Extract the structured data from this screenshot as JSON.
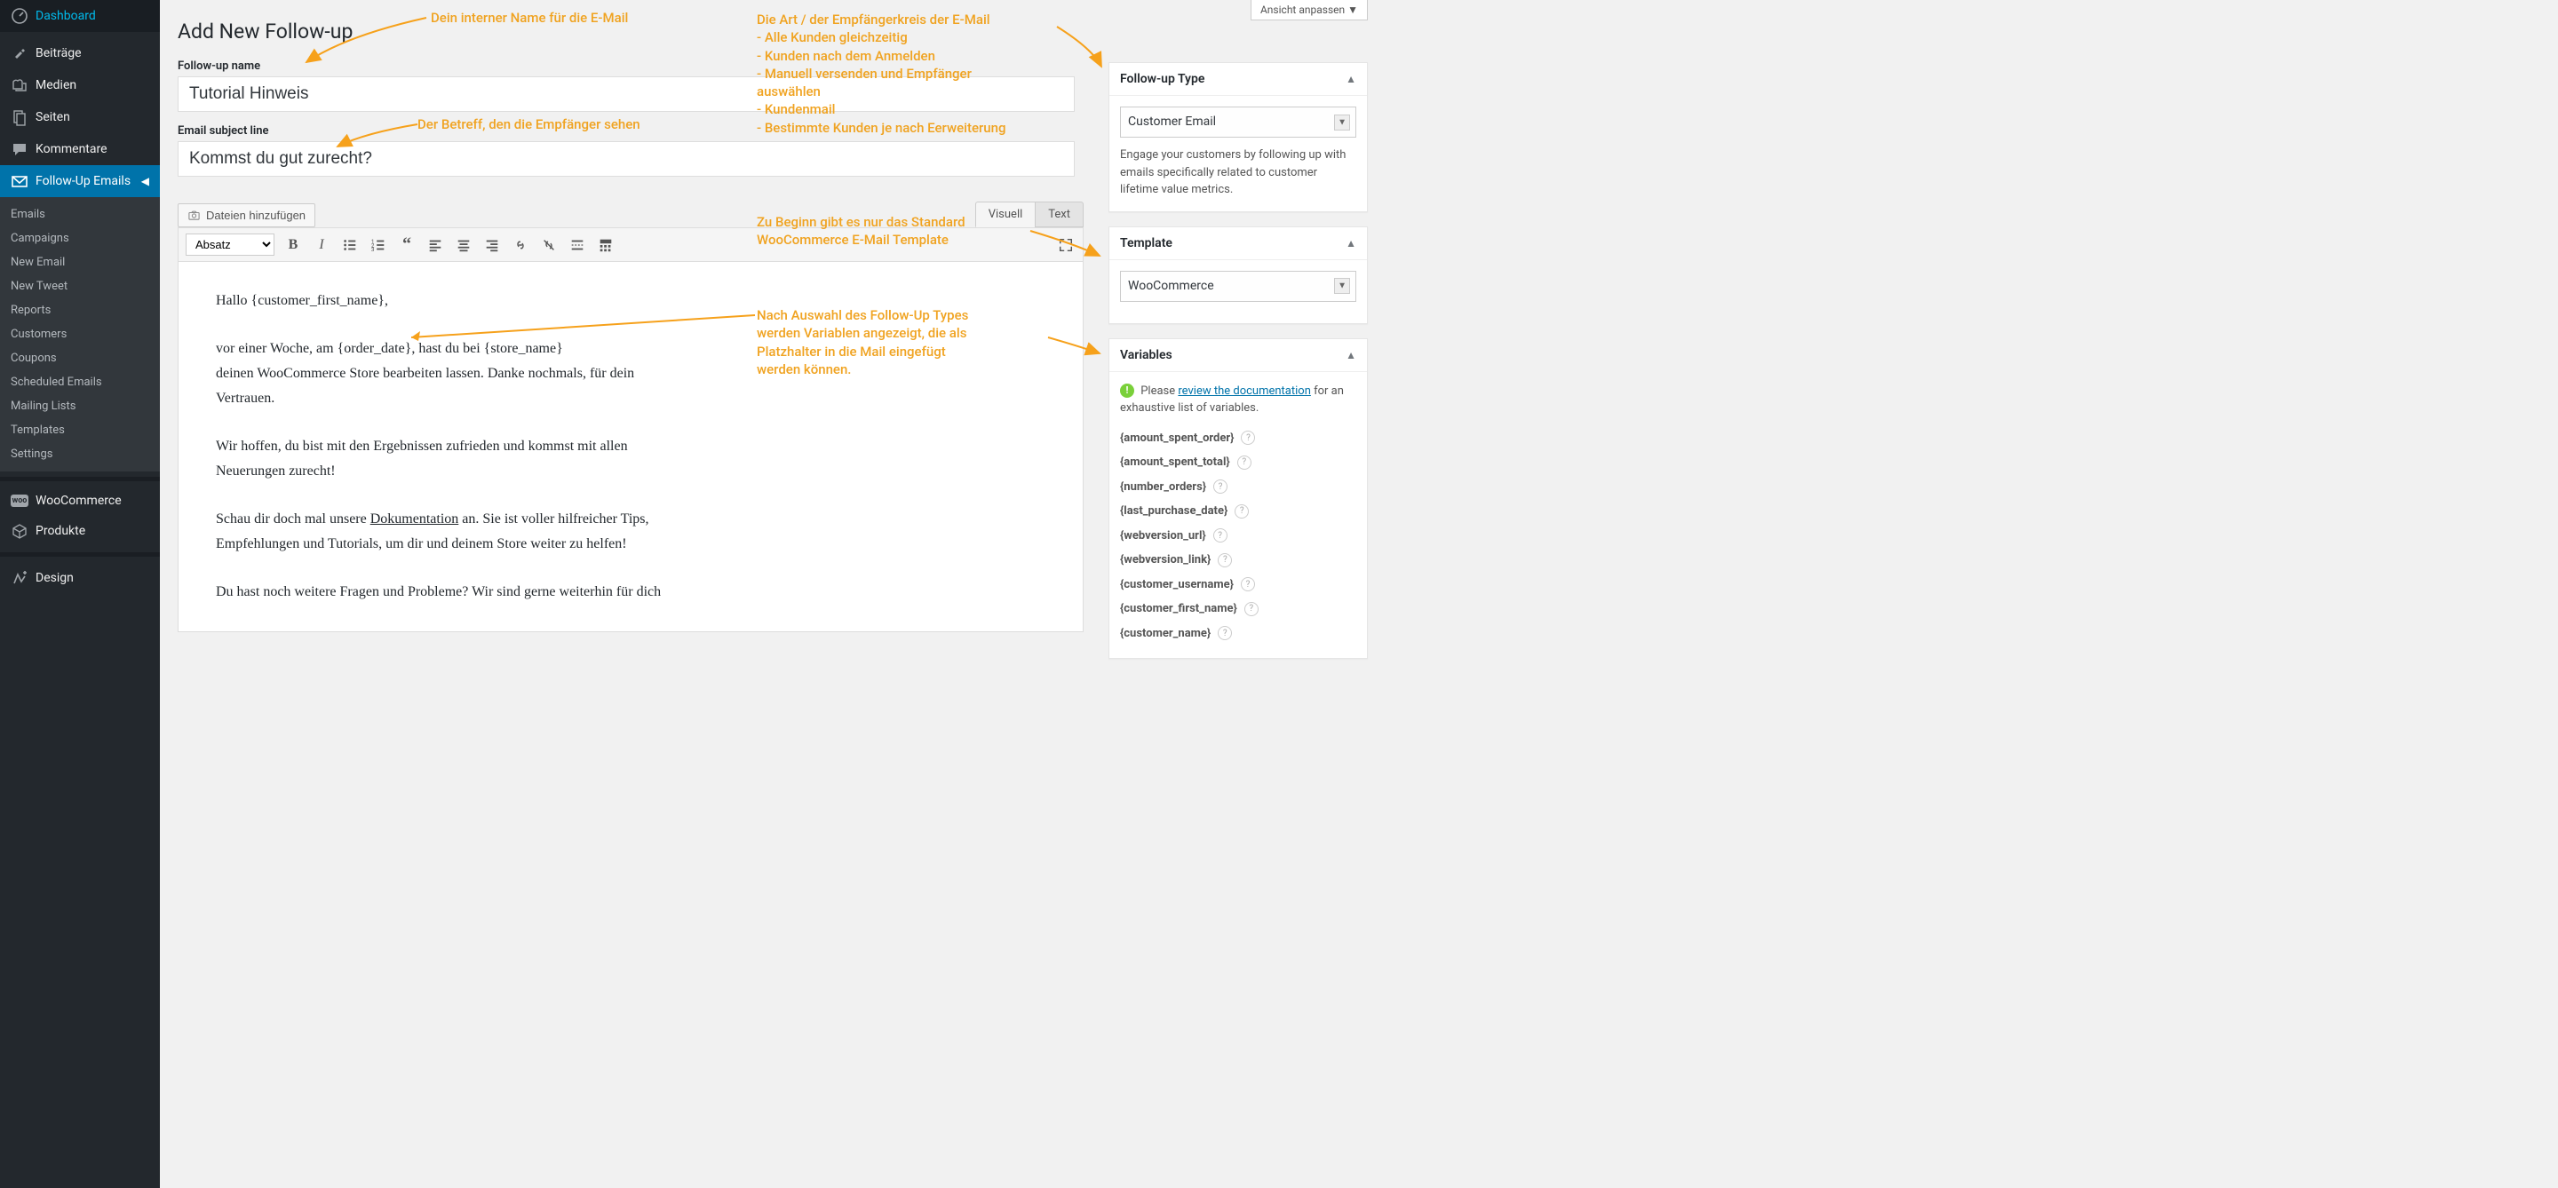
{
  "sidebar": {
    "items": [
      {
        "label": "Dashboard",
        "icon": "dashboard"
      },
      {
        "label": "Beiträge",
        "icon": "pin"
      },
      {
        "label": "Medien",
        "icon": "media"
      },
      {
        "label": "Seiten",
        "icon": "page"
      },
      {
        "label": "Kommentare",
        "icon": "comment"
      },
      {
        "label": "Follow-Up Emails",
        "icon": "mail",
        "active": true
      },
      {
        "label": "WooCommerce",
        "icon": "woo"
      },
      {
        "label": "Produkte",
        "icon": "product"
      },
      {
        "label": "Design",
        "icon": "design"
      }
    ],
    "subitems": [
      "Emails",
      "Campaigns",
      "New Email",
      "New Tweet",
      "Reports",
      "Customers",
      "Coupons",
      "Scheduled Emails",
      "Mailing Lists",
      "Templates",
      "Settings"
    ]
  },
  "screen_options": "Ansicht anpassen",
  "page_title": "Add New Follow-up",
  "fields": {
    "name_label": "Follow-up name",
    "name_value": "Tutorial Hinweis",
    "subject_label": "Email subject line",
    "subject_value": "Kommst du gut zurecht?"
  },
  "editor": {
    "add_media": "Dateien hinzufügen",
    "tab_visual": "Visuell",
    "tab_text": "Text",
    "format_select": "Absatz",
    "body": {
      "p1": "Hallo {customer_first_name},",
      "p2a": "vor einer Woche, am {order_date},  hast du bei {store_name}",
      "p2b": "deinen WooCommerce Store bearbeiten lassen. Danke nochmals, für dein",
      "p2c": "Vertrauen.",
      "p3a": "Wir hoffen, du bist mit den Ergebnissen zufrieden und kommst mit allen",
      "p3b": "Neuerungen zurecht!",
      "p4a_pre": "Schau dir doch mal unsere ",
      "p4a_link": "Dokumentation",
      "p4a_post": " an. Sie ist voller hilfreicher Tips,",
      "p4b": "Empfehlungen und Tutorials, um dir und deinem Store weiter zu helfen!",
      "p5": "Du hast noch weitere Fragen und Probleme? Wir sind gerne weiterhin für dich"
    }
  },
  "right": {
    "type": {
      "title": "Follow-up Type",
      "value": "Customer Email",
      "desc": "Engage your customers by following up with emails specifically related to customer lifetime value metrics."
    },
    "template": {
      "title": "Template",
      "value": "WooCommerce"
    },
    "variables": {
      "title": "Variables",
      "hint_pre": "Please ",
      "hint_link": "review the documentation",
      "hint_post": " for an exhaustive list of variables.",
      "list": [
        "{amount_spent_order}",
        "{amount_spent_total}",
        "{number_orders}",
        "{last_purchase_date}",
        "{webversion_url}",
        "{webversion_link}",
        "{customer_username}",
        "{customer_first_name}",
        "{customer_name}"
      ]
    }
  },
  "annotations": {
    "a1": "Dein interner Name für die E-Mail",
    "a2": "Der Betreff, den die Empfänger sehen",
    "a3_lines": [
      "Die Art / der Empfängerkreis der E-Mail",
      "- Alle Kunden gleichzeitig",
      "- Kunden nach dem Anmelden",
      "- Manuell versenden und Empfänger",
      "auswählen",
      "- Kundenmail",
      "- Bestimmte Kunden je nach Eerweiterung"
    ],
    "a4_lines": [
      "Zu Beginn gibt es nur das Standard",
      "WooCommerce E-Mail Template"
    ],
    "a5_lines": [
      "Nach Auswahl des Follow-Up Types",
      "werden Variablen angezeigt, die als",
      "Platzhalter in die Mail eingefügt",
      "werden können."
    ]
  }
}
